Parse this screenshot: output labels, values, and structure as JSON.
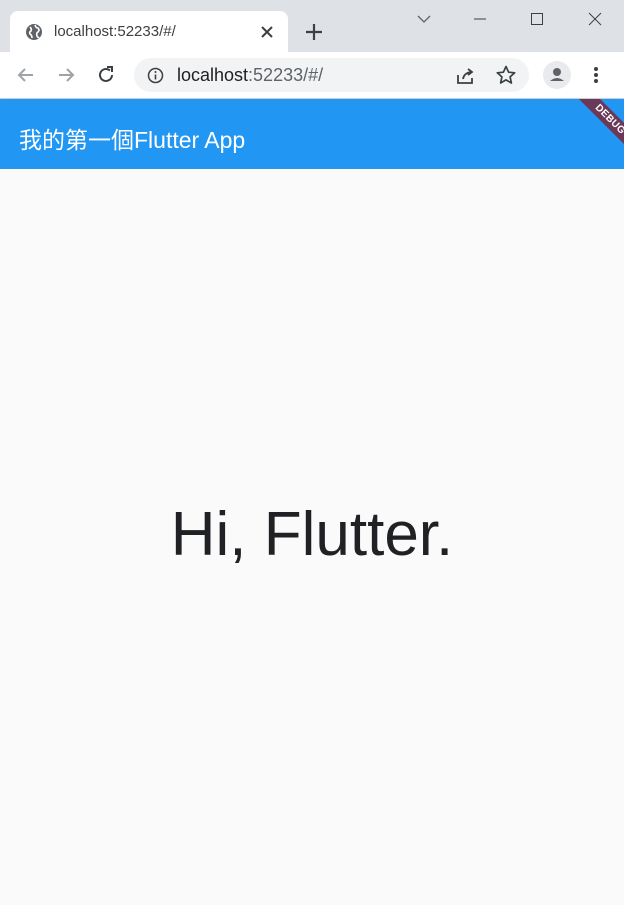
{
  "browser": {
    "tab_title": "localhost:52233/#/",
    "url_host": "localhost",
    "url_rest": ":52233/#/",
    "icons": {
      "favicon": "globe-icon",
      "tab_close": "close-icon",
      "new_tab": "plus-icon",
      "tab_search": "chevron-down-icon",
      "minimize": "minimize-icon",
      "maximize": "maximize-icon",
      "close_window": "close-icon",
      "back": "arrow-left-icon",
      "forward": "arrow-right-icon",
      "reload": "reload-icon",
      "site_info": "info-icon",
      "share": "share-icon",
      "bookmark": "star-icon",
      "profile": "person-icon",
      "menu": "kebab-menu-icon"
    }
  },
  "app": {
    "title": "我的第一個Flutter App",
    "debug_banner": "DEBUG",
    "body_text": "Hi, Flutter.",
    "colors": {
      "appbar": "#2196f3",
      "background": "#fafafa",
      "banner": "#78283c"
    }
  }
}
